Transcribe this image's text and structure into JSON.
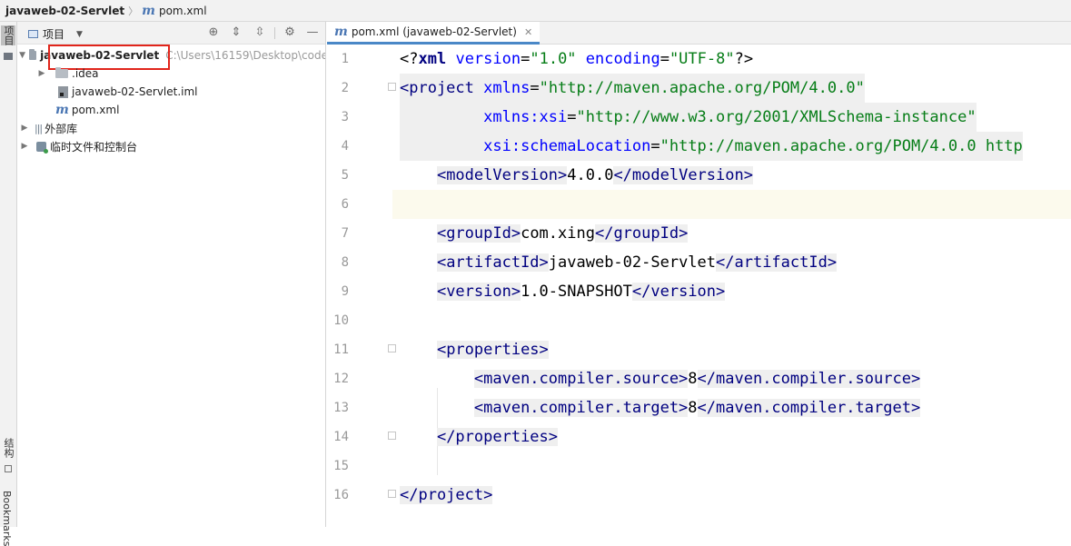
{
  "breadcrumb": {
    "project": "javaweb-02-Servlet",
    "file": "pom.xml"
  },
  "stripe": {
    "project_tab": "项目",
    "structure_tab": "结构",
    "bookmarks_tab": "Bookmarks"
  },
  "project_panel": {
    "title": "项目",
    "tree": [
      {
        "name": "javaweb-02-Servlet",
        "path": "C:\\Users\\16159\\Desktop\\code"
      },
      {
        "name": ".idea"
      },
      {
        "name": "javaweb-02-Servlet.iml"
      },
      {
        "name": "pom.xml"
      },
      {
        "name": "外部库"
      },
      {
        "name": "临时文件和控制台"
      }
    ]
  },
  "editor": {
    "tab_label": "pom.xml (javaweb-02-Servlet)",
    "current_line": 6,
    "lines": [
      {
        "n": "1",
        "text": "<?xml version=\"1.0\" encoding=\"UTF-8\"?>"
      },
      {
        "n": "2",
        "text": "<project xmlns=\"http://maven.apache.org/POM/4.0.0\""
      },
      {
        "n": "3",
        "text": "         xmlns:xsi=\"http://www.w3.org/2001/XMLSchema-instance\""
      },
      {
        "n": "4",
        "text": "         xsi:schemaLocation=\"http://maven.apache.org/POM/4.0.0 http"
      },
      {
        "n": "5",
        "text": "    <modelVersion>4.0.0</modelVersion>"
      },
      {
        "n": "6",
        "text": ""
      },
      {
        "n": "7",
        "text": "    <groupId>com.xing</groupId>"
      },
      {
        "n": "8",
        "text": "    <artifactId>javaweb-02-Servlet</artifactId>"
      },
      {
        "n": "9",
        "text": "    <version>1.0-SNAPSHOT</version>"
      },
      {
        "n": "10",
        "text": ""
      },
      {
        "n": "11",
        "text": "    <properties>"
      },
      {
        "n": "12",
        "text": "        <maven.compiler.source>8</maven.compiler.source>"
      },
      {
        "n": "13",
        "text": "        <maven.compiler.target>8</maven.compiler.target>"
      },
      {
        "n": "14",
        "text": "    </properties>"
      },
      {
        "n": "15",
        "text": ""
      },
      {
        "n": "16",
        "text": "</project>"
      }
    ]
  },
  "colors": {
    "tag": "#000080",
    "attr": "#0000ff",
    "value": "#067d17",
    "highlight_box": "#e1251b",
    "current_line": "#fcfaed"
  }
}
